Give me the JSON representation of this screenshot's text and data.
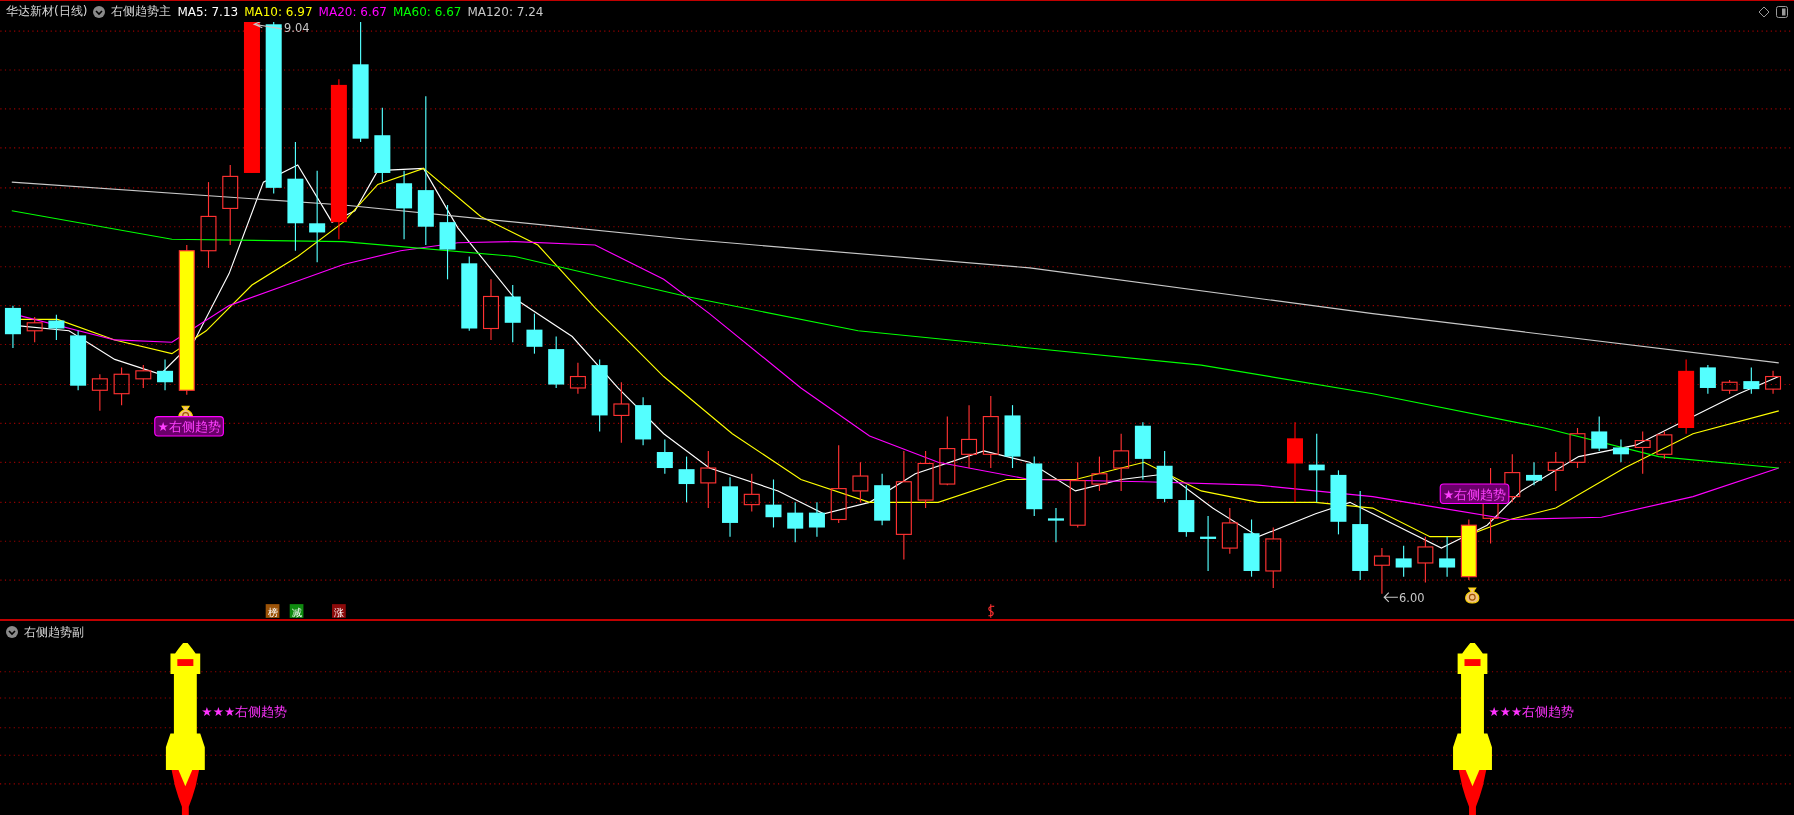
{
  "header": {
    "title": "华达新材(日线)",
    "indicator": "右侧趋势主",
    "ma_readings": [
      {
        "label": "MA5: 7.13",
        "color": "#ffffff"
      },
      {
        "label": "MA10: 6.97",
        "color": "#ffff00"
      },
      {
        "label": "MA20: 6.67",
        "color": "#ff00ff"
      },
      {
        "label": "MA60: 6.67",
        "color": "#00ff00"
      },
      {
        "label": "MA120: 7.24",
        "color": "#c8c8c8"
      }
    ]
  },
  "main_chart": {
    "high_label": "9.04",
    "low_label": "6.00",
    "signals": [
      {
        "text": "★右侧趋势"
      },
      {
        "text": "★右侧趋势"
      }
    ],
    "badges": [
      {
        "text": "榜",
        "color": "#9c5308"
      },
      {
        "text": "减",
        "color": "#0f8a0f"
      },
      {
        "text": "涨",
        "color": "#8c0a0a"
      }
    ]
  },
  "sub_panel": {
    "title": "右侧趋势副",
    "signals": [
      {
        "text": "★★★右侧趋势"
      },
      {
        "text": "★★★右侧趋势"
      }
    ]
  }
}
